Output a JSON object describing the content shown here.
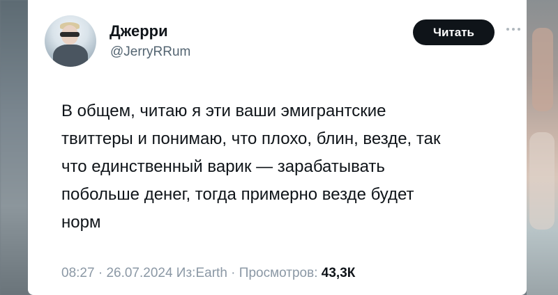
{
  "author": {
    "name": "Джерри",
    "handle": "@JerryRRum"
  },
  "follow_button": {
    "label": "Читать"
  },
  "more_icon": "more-horizontal-icon",
  "tweet": {
    "text": "В общем, читаю я эти ваши эмигрантские\nтвиттеры и понимаю, что плохо, блин, везде, так\nчто единственный варик — зарабатывать\nпобольше денег, тогда примерно везде будет\nнорм"
  },
  "meta": {
    "time": "08:27",
    "separator1": " · ",
    "date": "26.07.2024",
    "source_prefix": " Из:",
    "source": "Earth",
    "separator2": " · ",
    "views_label": "Просмотров: ",
    "views_count": "43,3К"
  },
  "colors": {
    "text": "#0f1419",
    "secondary": "#536471",
    "button_bg": "#0f1419"
  }
}
